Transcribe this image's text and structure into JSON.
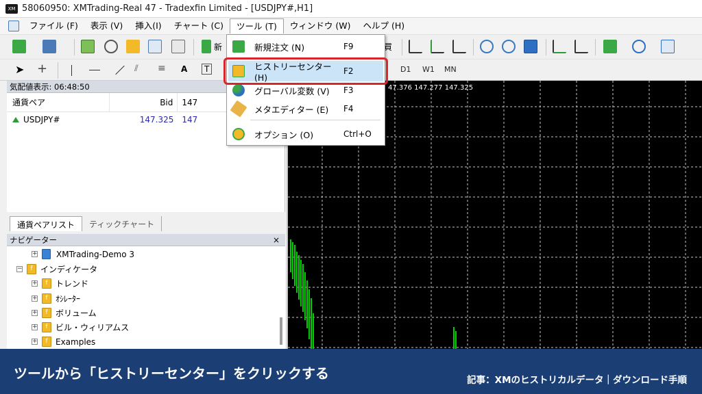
{
  "window": {
    "title": "58060950: XMTrading-Real 47 - Tradexfin Limited - [USDJPY#,H1]",
    "app_icon_text": "XM"
  },
  "menubar": {
    "items": [
      {
        "label": "ファイル (F)"
      },
      {
        "label": "表示 (V)"
      },
      {
        "label": "挿入(I)"
      },
      {
        "label": "チャート (C)"
      },
      {
        "label": "ツール (T)",
        "active": true
      },
      {
        "label": "ウィンドウ (W)"
      },
      {
        "label": "ヘルプ (H)"
      }
    ]
  },
  "toolbar": {
    "new_order_fragment": "新",
    "timeframes": [
      "D1",
      "W1",
      "MN"
    ]
  },
  "tools_menu": {
    "items": [
      {
        "label": "新規注文 (N)",
        "shortcut": "F9",
        "icon": "new-order-icon"
      },
      {
        "label": "ヒストリーセンター (H)",
        "shortcut": "F2",
        "icon": "history-center-icon",
        "highlighted": true
      },
      {
        "label": "グローバル変数 (V)",
        "shortcut": "F3",
        "icon": "global-variables-icon"
      },
      {
        "label": "メタエディター (E)",
        "shortcut": "F4",
        "icon": "metaeditor-icon"
      },
      {
        "label": "オプション (O)",
        "shortcut": "Ctrl+O",
        "icon": "options-icon"
      }
    ]
  },
  "market_watch": {
    "header": "気配値表示: 06:48:50",
    "columns": {
      "pair": "通貨ペア",
      "bid": "Bid",
      "ask": "147"
    },
    "rows": [
      {
        "pair": "USDJPY#",
        "bid": "147.325",
        "ask": "147"
      }
    ],
    "tabs": [
      "通貨ペアリスト",
      "ティックチャート"
    ]
  },
  "navigator": {
    "header": "ナビゲーター",
    "close": "×",
    "items": [
      {
        "label": "XMTrading-Demo 3",
        "icon": "account-icon"
      },
      {
        "label": "インディケータ",
        "icon": "folder-icon"
      },
      {
        "label": "トレンド",
        "icon": "folder-icon"
      },
      {
        "label": "ｵｼﾚｰﾀｰ",
        "icon": "folder-icon"
      },
      {
        "label": "ボリューム",
        "icon": "folder-icon"
      },
      {
        "label": "ビル・ウィリアムス",
        "icon": "folder-icon"
      },
      {
        "label": "Examples",
        "icon": "folder-icon"
      }
    ]
  },
  "chart": {
    "price_text": "47.376 147.277 147.325",
    "background": "#000000",
    "grid_color": "#c8c8c8",
    "candle_color": "#00cc00"
  },
  "banner": {
    "main": "ツールから「ヒストリーセンター」をクリックする",
    "sub": "記事：XMのヒストリカルデータ｜ダウンロード手順",
    "background": "#1b3f74"
  }
}
